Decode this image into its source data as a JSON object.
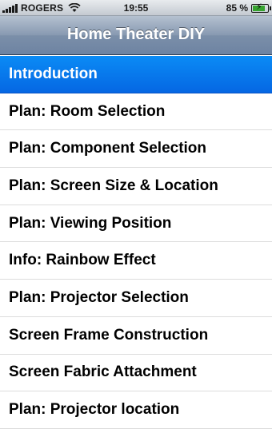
{
  "status_bar": {
    "carrier": "ROGERS",
    "time": "19:55",
    "battery_percent": "85 %",
    "battery_level": 0.85
  },
  "navbar": {
    "title": "Home Theater DIY"
  },
  "menu": {
    "selected_index": 0,
    "items": [
      {
        "label": "Introduction"
      },
      {
        "label": "Plan: Room Selection"
      },
      {
        "label": "Plan: Component Selection"
      },
      {
        "label": "Plan: Screen Size & Location"
      },
      {
        "label": "Plan: Viewing Position"
      },
      {
        "label": "Info: Rainbow Effect"
      },
      {
        "label": "Plan: Projector Selection"
      },
      {
        "label": "Screen Frame Construction"
      },
      {
        "label": "Screen Fabric Attachment"
      },
      {
        "label": "Plan: Projector location"
      }
    ]
  },
  "colors": {
    "selected_row": "#0567e3",
    "navbar": "#7b8fa9"
  }
}
